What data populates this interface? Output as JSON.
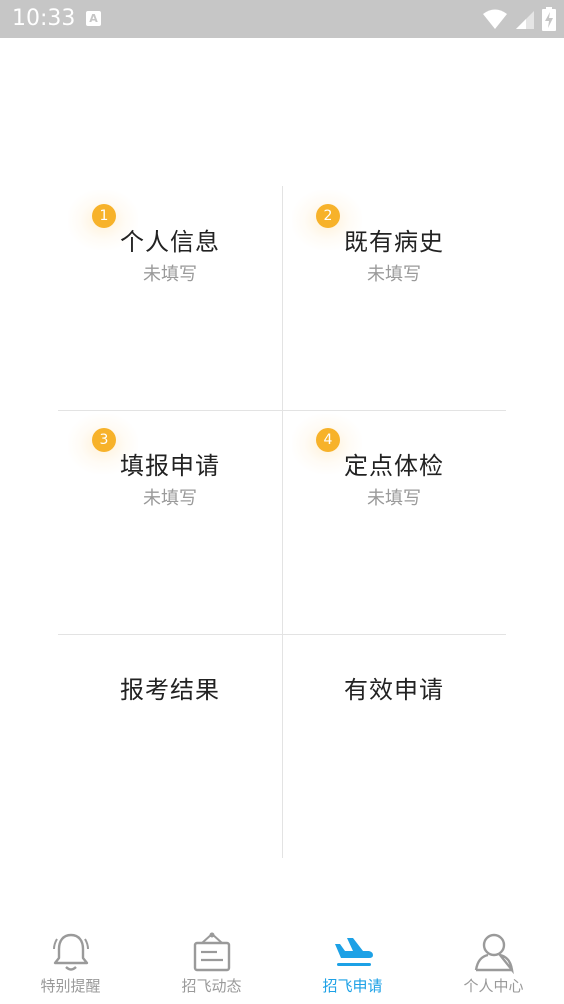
{
  "status_bar": {
    "time": "10:33",
    "notification_icon": "A"
  },
  "grid": {
    "cells": [
      {
        "badge": "1",
        "title": "个人信息",
        "status": "未填写"
      },
      {
        "badge": "2",
        "title": "既有病史",
        "status": "未填写"
      },
      {
        "badge": "3",
        "title": "填报申请",
        "status": "未填写"
      },
      {
        "badge": "4",
        "title": "定点体检",
        "status": "未填写"
      },
      {
        "title": "报考结果"
      },
      {
        "title": "有效申请"
      }
    ]
  },
  "bottom_nav": {
    "items": [
      {
        "label": "特别提醒",
        "icon": "bell-icon"
      },
      {
        "label": "招飞动态",
        "icon": "signboard-icon"
      },
      {
        "label": "招飞申请",
        "icon": "airplane-icon",
        "active": true
      },
      {
        "label": "个人中心",
        "icon": "person-icon"
      }
    ],
    "active_color": "#1da1e6",
    "inactive_color": "#9a9a9a"
  },
  "colors": {
    "badge": "#f7b22a",
    "status_bar": "#c6c6c6"
  }
}
